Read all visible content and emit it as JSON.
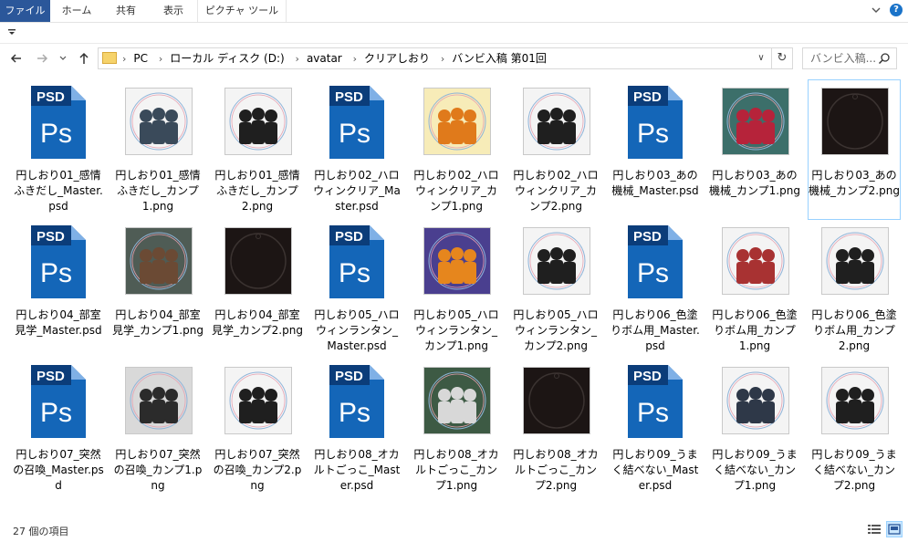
{
  "ribbon": {
    "tabs": [
      "ファイル",
      "ホーム",
      "共有",
      "表示",
      "ピクチャ ツール"
    ]
  },
  "qat": {
    "down_icon": "qat-dropdown-icon"
  },
  "address": {
    "crumbs": [
      "PC",
      "ローカル ディスク (D:)",
      "avatar",
      "クリアしおり",
      "バンビ入稿 第01回"
    ]
  },
  "search": {
    "placeholder": "バンビ入稿..."
  },
  "files": [
    {
      "type": "psd",
      "name": "円しおり01_感情ふきだし_Master.psd"
    },
    {
      "type": "color",
      "name": "円しおり01_感情ふきだし_カンプ1.png",
      "bg": "#f4f4f4",
      "fg": "#3a4a5a"
    },
    {
      "type": "silhouette",
      "name": "円しおり01_感情ふきだし_カンプ2.png",
      "bg": "#f4f4f4",
      "fg": "#1f1f1f"
    },
    {
      "type": "psd",
      "name": "円しおり02_ハロウィンクリア_Master.psd"
    },
    {
      "type": "color",
      "name": "円しおり02_ハロウィンクリア_カンプ1.png",
      "bg": "#f7ecb8",
      "fg": "#e07a1b"
    },
    {
      "type": "silhouette",
      "name": "円しおり02_ハロウィンクリア_カンプ2.png",
      "bg": "#f4f4f4",
      "fg": "#1f1f1f"
    },
    {
      "type": "psd",
      "name": "円しおり03_あの機械_Master.psd"
    },
    {
      "type": "color",
      "name": "円しおり03_あの機械_カンプ1.png",
      "bg": "#3c6f6a",
      "fg": "#b6233a"
    },
    {
      "type": "dark",
      "name": "円しおり03_あの機械_カンプ2.png",
      "bg": "#1c1514",
      "fg": "#3b3331"
    },
    {
      "type": "psd",
      "name": "円しおり04_部室見学_Master.psd"
    },
    {
      "type": "color",
      "name": "円しおり04_部室見学_カンプ1.png",
      "bg": "#4f5c55",
      "fg": "#6b4a34"
    },
    {
      "type": "dark",
      "name": "円しおり04_部室見学_カンプ2.png",
      "bg": "#1c1514",
      "fg": "#3b3331"
    },
    {
      "type": "psd",
      "name": "円しおり05_ハロウィンランタン_Master.psd"
    },
    {
      "type": "color",
      "name": "円しおり05_ハロウィンランタン_カンプ1.png",
      "bg": "#4a3f8f",
      "fg": "#e6861d"
    },
    {
      "type": "silhouette",
      "name": "円しおり05_ハロウィンランタン_カンプ2.png",
      "bg": "#f4f4f4",
      "fg": "#1f1f1f"
    },
    {
      "type": "psd",
      "name": "円しおり06_色塗りボム用_Master.psd"
    },
    {
      "type": "color",
      "name": "円しおり06_色塗りボム用_カンプ1.png",
      "bg": "#f4f4f4",
      "fg": "#a83232"
    },
    {
      "type": "silhouette",
      "name": "円しおり06_色塗りボム用_カンプ2.png",
      "bg": "#f4f4f4",
      "fg": "#1f1f1f"
    },
    {
      "type": "psd",
      "name": "円しおり07_突然の召喚_Master.psd"
    },
    {
      "type": "color",
      "name": "円しおり07_突然の召喚_カンプ1.png",
      "bg": "#d9d9d9",
      "fg": "#2b2b2b"
    },
    {
      "type": "silhouette",
      "name": "円しおり07_突然の召喚_カンプ2.png",
      "bg": "#f4f4f4",
      "fg": "#1f1f1f"
    },
    {
      "type": "psd",
      "name": "円しおり08_オカルトごっこ_Master.psd"
    },
    {
      "type": "color",
      "name": "円しおり08_オカルトごっこ_カンプ1.png",
      "bg": "#3d5a44",
      "fg": "#d8d8d8"
    },
    {
      "type": "dark",
      "name": "円しおり08_オカルトごっこ_カンプ2.png",
      "bg": "#1c1514",
      "fg": "#3b3331"
    },
    {
      "type": "psd",
      "name": "円しおり09_うまく結べない_Master.psd"
    },
    {
      "type": "color",
      "name": "円しおり09_うまく結べない_カンプ1.png",
      "bg": "#f4f4f4",
      "fg": "#2e3848"
    },
    {
      "type": "silhouette",
      "name": "円しおり09_うまく結べない_カンプ2.png",
      "bg": "#f4f4f4",
      "fg": "#1f1f1f"
    }
  ],
  "selected_index": 8,
  "psd_label": "PSD",
  "psd_letters": "Ps",
  "status": {
    "count_text": "27 個の項目"
  },
  "colors": {
    "accent": "#2b579a",
    "psd_blue": "#1466b8",
    "psd_dark": "#0b3d7a"
  }
}
